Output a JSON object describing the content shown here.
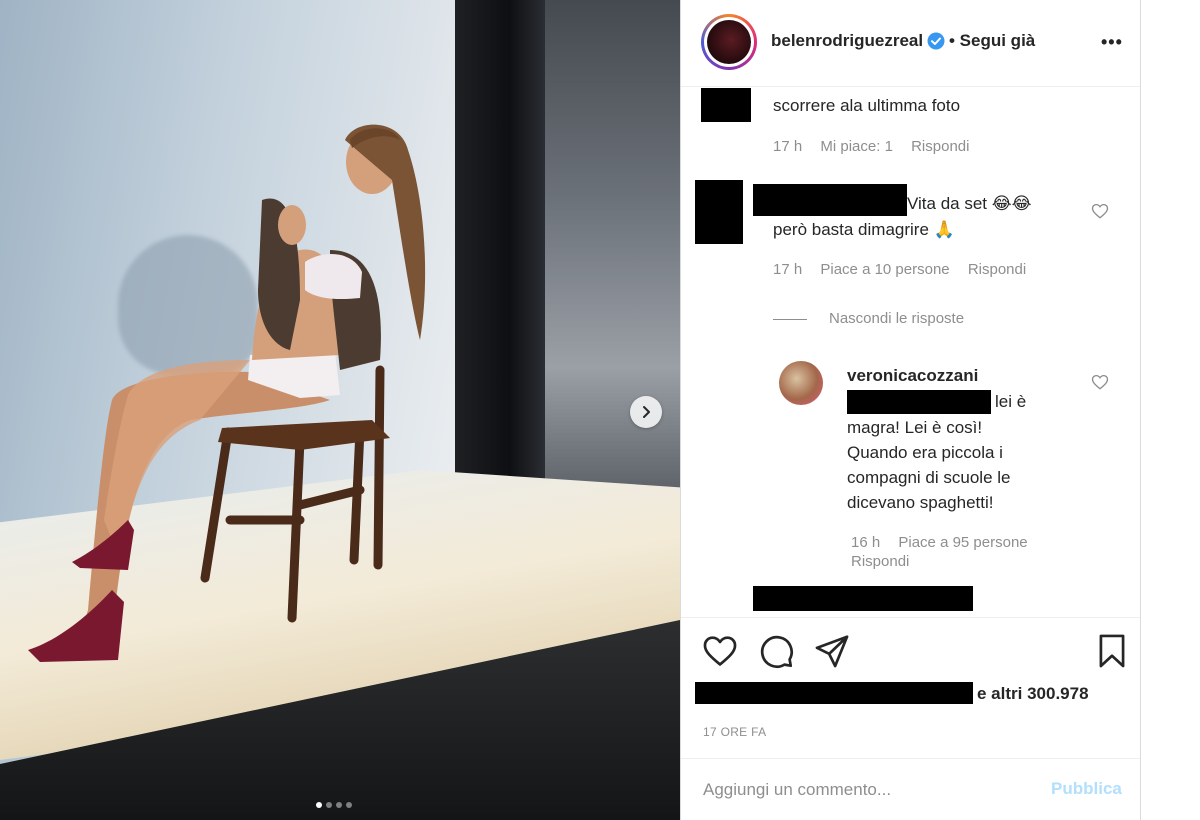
{
  "post": {
    "username": "belenrodriguezreal",
    "follow_label": "• Segui già",
    "more_label": "•••",
    "slide_count": 4,
    "active_slide": 1
  },
  "comments": [
    {
      "text": "scorrere ala ultimma foto",
      "time": "17 h",
      "likes": "Mi piace: 1",
      "reply": "Rispondi"
    },
    {
      "text_line1": "Vita da set 😂😂",
      "text_line2": "però basta dimagrire 🙏",
      "time": "17 h",
      "likes": "Piace a 10 persone",
      "reply": "Rispondi",
      "hide_replies": "Nascondi le risposte",
      "replies": [
        {
          "username": "veronicacozzani",
          "text_tail": "lei è",
          "text_lines": [
            "magra! Lei è così!",
            "Quando era piccola i",
            "compagni di scuole le",
            "dicevano spaghetti!"
          ],
          "time": "16 h",
          "likes": "Piace a 95 persone",
          "reply": "Rispondi"
        }
      ]
    }
  ],
  "likes_summary": "e altri 300.978",
  "time_ago": "17 ORE FA",
  "add_comment": {
    "placeholder": "Aggiungi un commento...",
    "publish_label": "Pubblica"
  },
  "colors": {
    "accent_publish": "#b2dffc",
    "verified": "#3897f0",
    "meta_text": "#8e8e8e"
  },
  "icons": [
    "heart-icon",
    "comment-icon",
    "share-icon",
    "bookmark-icon",
    "verified-icon",
    "chevron-right-icon"
  ]
}
